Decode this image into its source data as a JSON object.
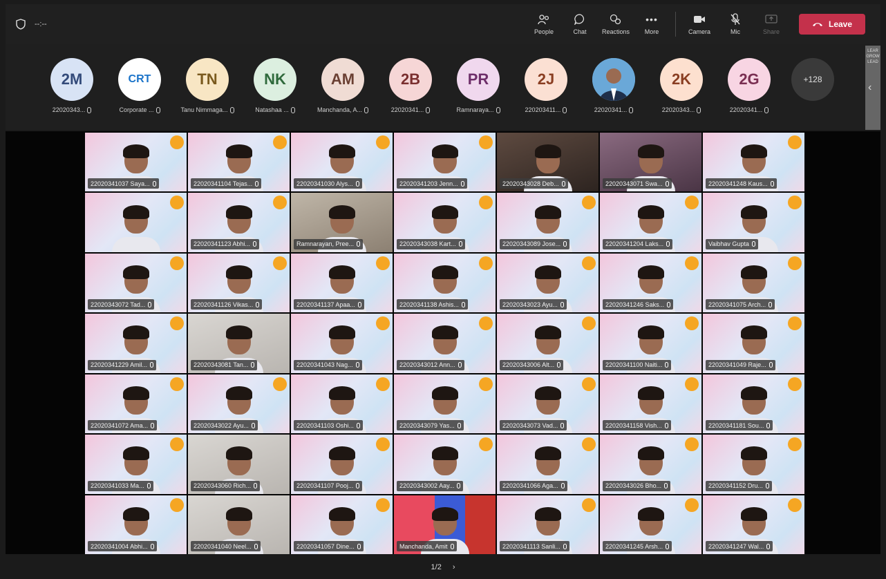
{
  "topbar": {
    "timer": "--:--",
    "controls": [
      {
        "label": "People",
        "icon": "people-icon"
      },
      {
        "label": "Chat",
        "icon": "chat-icon"
      },
      {
        "label": "Reactions",
        "icon": "reactions-icon"
      },
      {
        "label": "More",
        "icon": "more-icon"
      }
    ],
    "media": [
      {
        "label": "Camera",
        "icon": "camera-icon"
      },
      {
        "label": "Mic",
        "icon": "mic-off-icon"
      },
      {
        "label": "Share",
        "icon": "share-icon"
      }
    ],
    "leave_label": "Leave"
  },
  "strip": {
    "people": [
      {
        "initials": "2M",
        "name": "22020343...",
        "color": "#d8e3f5",
        "text": "#334a7a"
      },
      {
        "initials": "CRT",
        "name": "Corporate ...",
        "color": "#ffffff",
        "text": "#1a73c9"
      },
      {
        "initials": "TN",
        "name": "Tanu Nimmaga...",
        "color": "#f8e6c4",
        "text": "#7a5a1e"
      },
      {
        "initials": "NK",
        "name": "Natashaa ...",
        "color": "#dcefe0",
        "text": "#2f6a3c"
      },
      {
        "initials": "AM",
        "name": "Manchanda, A...",
        "color": "#f0dcd4",
        "text": "#6b4033"
      },
      {
        "initials": "2B",
        "name": "22020341...",
        "color": "#f6d6d6",
        "text": "#7a2f2f"
      },
      {
        "initials": "PR",
        "name": "Ramnaraya...",
        "color": "#f0d8ee",
        "text": "#6e2f6a"
      },
      {
        "initials": "2J",
        "name": "220203411...",
        "color": "#fbe0d3",
        "text": "#8a3e22"
      },
      {
        "initials": "",
        "name": "22020341...",
        "color": "#6aa8d8",
        "text": "#fff"
      },
      {
        "initials": "2K",
        "name": "22020343...",
        "color": "#fde0cf",
        "text": "#8a3e22"
      },
      {
        "initials": "2G",
        "name": "22020341...",
        "color": "#f8d5e3",
        "text": "#7a2f52"
      }
    ],
    "more_count": "+128",
    "side_text": "LEAR GROW LEAD"
  },
  "tiles": [
    "22020341037 Saya...",
    "22020341104 Tejas...",
    "22020341030 Alys...",
    "22020341203 Jenn...",
    "22020343028 Deb...",
    "22020343071 Swa...",
    "22020341248 Kaus...",
    "",
    "22020341123 Abhi...",
    "Ramnarayan, Pree...",
    "22020343038 Kart...",
    "22020343089 Jose...",
    "22020341204 Laks...",
    "Vaibhav Gupta",
    "22020343072 Tad...",
    "22020341126 Vikas...",
    "22020341137 Apaa...",
    "22020341138 Ashis...",
    "22020343023 Ayu...",
    "22020341246 Saks...",
    "22020341075 Arch...",
    "22020341229 Amil...",
    "22020343081 Tan...",
    "22020341043 Nag...",
    "22020343012 Ann...",
    "22020343006 Alt...",
    "22020341100 Naiti...",
    "22020341049 Raje...",
    "22020341072 Ama...",
    "22020343022 Ayu...",
    "22020341103 Oshi...",
    "22020343079 Yas...",
    "22020343073 Vad...",
    "22020341158 Vish...",
    "22020341181 Sou...",
    "22020341033 Ma...",
    "22020343060 Rich...",
    "22020341107 Pooj...",
    "22020343002 Aay...",
    "22020341066 Aga...",
    "22020343026 Bho...",
    "22020341152 Dru...",
    "22020341004 Abhi...",
    "22020341040 Neel...",
    "22020341057 Dine...",
    "Manchanda, Amit",
    "22020341113 Sanli...",
    "22020341245 Arsh...",
    "22020341247 Wal..."
  ],
  "pager": {
    "label": "1/2",
    "next": "›"
  }
}
